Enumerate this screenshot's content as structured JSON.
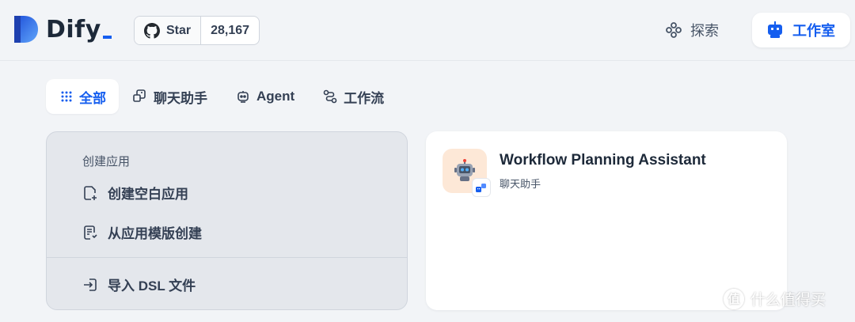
{
  "header": {
    "logo_text": "Dify",
    "github": {
      "star_label": "Star",
      "count": "28,167"
    },
    "explore_label": "探索",
    "studio_label": "工作室"
  },
  "tabs": [
    {
      "label": "全部",
      "icon": "grid-icon",
      "active": true
    },
    {
      "label": "聊天助手",
      "icon": "chat-assistant-icon",
      "active": false
    },
    {
      "label": "Agent",
      "icon": "robot-icon",
      "active": false
    },
    {
      "label": "工作流",
      "icon": "workflow-icon",
      "active": false
    }
  ],
  "create_card": {
    "title": "创建应用",
    "items": [
      {
        "label": "创建空白应用",
        "icon": "new-file-icon"
      },
      {
        "label": "从应用模版创建",
        "icon": "template-icon"
      },
      {
        "label": "导入 DSL 文件",
        "icon": "import-icon"
      }
    ]
  },
  "apps": [
    {
      "name": "Workflow Planning Assistant",
      "type": "聊天助手",
      "icon": "robot-emoji",
      "icon_bg": "#fde8d7"
    }
  ],
  "watermark": {
    "text": "什么值得买",
    "mark": "值"
  },
  "colors": {
    "accent": "#155eef",
    "background": "#f2f4f7",
    "text": "#1d2939"
  }
}
